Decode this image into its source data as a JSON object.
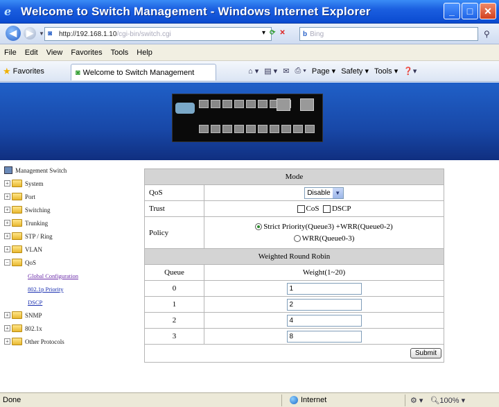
{
  "window": {
    "title": "Welcome to Switch Management - Windows Internet Explorer"
  },
  "address": {
    "url": "http://192.168.1.10",
    "url_rest": "/cgi-bin/switch.cgi",
    "search_logo": "Bing",
    "search_placeholder": "Bing"
  },
  "menu": [
    "File",
    "Edit",
    "View",
    "Favorites",
    "Tools",
    "Help"
  ],
  "favorites_label": "Favorites",
  "tab_label": "Welcome to Switch Management",
  "commands": {
    "page": "Page",
    "safety": "Safety",
    "tools": "Tools"
  },
  "tree": {
    "root": "Management Switch",
    "items": [
      "System",
      "Port",
      "Switching",
      "Trunking",
      "STP / Ring",
      "VLAN",
      "QoS"
    ],
    "qos_children": [
      "Global Configuration",
      "802.1p Priority",
      "DSCP"
    ],
    "after": [
      "SNMP",
      "802.1x",
      "Other Protocols"
    ]
  },
  "form": {
    "mode_header": "Mode",
    "qos_label": "QoS",
    "qos_value": "Disable",
    "trust_label": "Trust",
    "trust_cos": "CoS",
    "trust_dscp": "DSCP",
    "policy_label": "Policy",
    "policy_opt1": "Strict Priority(Queue3) +WRR(Queue0-2)",
    "policy_opt2": "WRR(Queue0-3)",
    "wrr_header": "Weighted Round Robin",
    "queue_header": "Queue",
    "weight_header": "Weight(1~20)",
    "queues": [
      {
        "queue": "0",
        "weight": "1"
      },
      {
        "queue": "1",
        "weight": "2"
      },
      {
        "queue": "2",
        "weight": "4"
      },
      {
        "queue": "3",
        "weight": "8"
      }
    ],
    "submit_label": "Submit"
  },
  "status": {
    "left": "Done",
    "zone": "Internet",
    "zoom": "100%"
  }
}
